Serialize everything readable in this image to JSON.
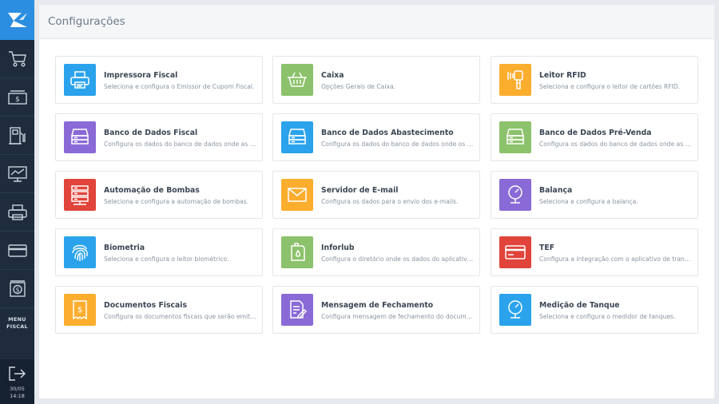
{
  "header": {
    "title": "Configurações"
  },
  "sidebar": {
    "menu_label": "MENU FISCAL",
    "menu_line1": "MENU",
    "menu_line2": "FISCAL",
    "date": "30/05",
    "time": "14:18",
    "nav_icons": [
      "cart-icon",
      "cash-icon",
      "fuel-pump-icon",
      "monitor-chart-icon",
      "printer-icon",
      "credit-card-icon",
      "safe-icon"
    ]
  },
  "colors": {
    "blue": "#2aa3ec",
    "green": "#8cc26b",
    "orange": "#fbad2e",
    "purple": "#8a6ad6",
    "red": "#e0443a"
  },
  "cards": [
    {
      "title": "Impressora Fiscal",
      "desc": "Seleciona e configura o Emissor de Cupom Fiscal.",
      "icon": "printer-icon",
      "color": "#2aa3ec"
    },
    {
      "title": "Caixa",
      "desc": "Opções Gerais de Caixa.",
      "icon": "basket-icon",
      "color": "#8cc26b"
    },
    {
      "title": "Leitor RFID",
      "desc": "Seleciona e configura o leitor de cartões RFID.",
      "icon": "rfid-reader-icon",
      "color": "#fbad2e"
    },
    {
      "title": "Banco de Dados Fiscal",
      "desc": "Configura os dados do banco de dados onde as informações fiscais são armazenadas.",
      "icon": "database-icon",
      "color": "#8a6ad6"
    },
    {
      "title": "Banco de Dados Abastecimento",
      "desc": "Configura os dados do banco de dados onde os abastecimentos são armazenados.",
      "icon": "database-icon",
      "color": "#2aa3ec"
    },
    {
      "title": "Banco de Dados Pré-Venda",
      "desc": "Configura os dados do banco de dados onde as pré-vendas são armazenadas.",
      "icon": "database-icon",
      "color": "#8cc26b"
    },
    {
      "title": "Automação de Bombas",
      "desc": "Seleciona e configura a automação de bombas.",
      "icon": "server-icon",
      "color": "#e0443a"
    },
    {
      "title": "Servidor de E-mail",
      "desc": "Configura os dados para o envio dos e-mails.",
      "icon": "envelope-icon",
      "color": "#fbad2e"
    },
    {
      "title": "Balança",
      "desc": "Seleciona e configura a balança.",
      "icon": "gauge-icon",
      "color": "#8a6ad6"
    },
    {
      "title": "Biometria",
      "desc": "Seleciona e configura o leitor biométrico.",
      "icon": "fingerprint-icon",
      "color": "#2aa3ec"
    },
    {
      "title": "Inforlub",
      "desc": "Configura o diretório onde os dados do aplicativo Inforlub são armazenados.",
      "icon": "oil-can-icon",
      "color": "#8cc26b"
    },
    {
      "title": "TEF",
      "desc": "Configura a integração com o aplicativo de transferência eletrônica.",
      "icon": "credit-card-icon",
      "color": "#e0443a"
    },
    {
      "title": "Documentos Fiscais",
      "desc": "Configura os documentos fiscais que serão emitidos.",
      "icon": "receipt-icon",
      "color": "#fbad2e"
    },
    {
      "title": "Mensagem de Fechamento",
      "desc": "Configura mensagem de fechamento do documento fiscal.",
      "icon": "document-edit-icon",
      "color": "#8a6ad6"
    },
    {
      "title": "Medição de Tanque",
      "desc": "Seleciona e configura o medidor de tanques.",
      "icon": "gauge-icon",
      "color": "#2aa3ec"
    }
  ]
}
